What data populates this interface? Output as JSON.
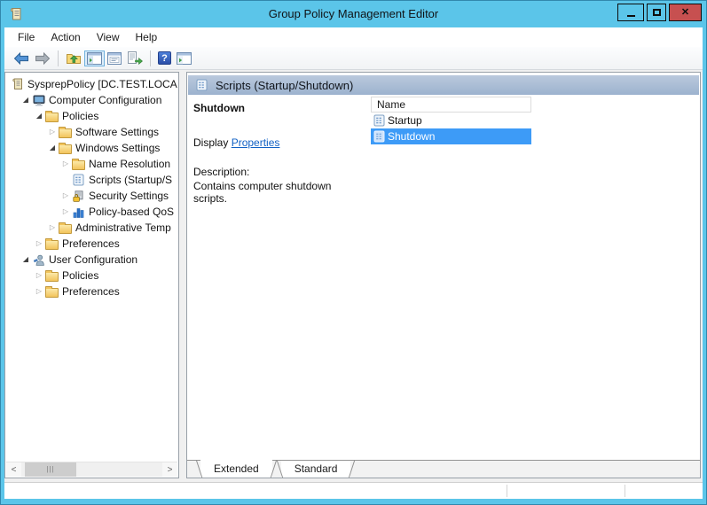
{
  "window": {
    "title": "Group Policy Management Editor",
    "accent_color": "#5bc5e9",
    "close_button_color": "#c75050"
  },
  "menu": {
    "items": [
      {
        "label": "File"
      },
      {
        "label": "Action"
      },
      {
        "label": "View"
      },
      {
        "label": "Help"
      }
    ]
  },
  "toolbar": {
    "icons": [
      "back",
      "forward",
      "up-one-level",
      "show-console-tree",
      "properties",
      "export-list",
      "help",
      "new-window"
    ]
  },
  "tree": {
    "items": [
      {
        "label": "SysprepPolicy [DC.TEST.LOCAL]",
        "level": 0,
        "state": "none",
        "icon": "gpo-scroll"
      },
      {
        "label": "Computer Configuration",
        "level": 1,
        "state": "expanded",
        "icon": "computer"
      },
      {
        "label": "Policies",
        "level": 2,
        "state": "expanded",
        "icon": "folder"
      },
      {
        "label": "Software Settings",
        "level": 3,
        "state": "collapsed",
        "icon": "folder"
      },
      {
        "label": "Windows Settings",
        "level": 3,
        "state": "expanded",
        "icon": "folder"
      },
      {
        "label": "Name Resolution",
        "level": 4,
        "state": "collapsed",
        "icon": "folder"
      },
      {
        "label": "Scripts (Startup/S",
        "level": 4,
        "state": "none",
        "icon": "scripts"
      },
      {
        "label": "Security Settings",
        "level": 4,
        "state": "collapsed",
        "icon": "security"
      },
      {
        "label": "Policy-based QoS",
        "level": 4,
        "state": "collapsed",
        "icon": "qos"
      },
      {
        "label": "Administrative Temp",
        "level": 3,
        "state": "collapsed",
        "icon": "folder"
      },
      {
        "label": "Preferences",
        "level": 2,
        "state": "collapsed",
        "icon": "folder"
      },
      {
        "label": "User Configuration",
        "level": 1,
        "state": "expanded",
        "icon": "user"
      },
      {
        "label": "Policies",
        "level": 2,
        "state": "collapsed",
        "icon": "folder"
      },
      {
        "label": "Preferences",
        "level": 2,
        "state": "collapsed",
        "icon": "folder"
      }
    ]
  },
  "content": {
    "header_title": "Scripts (Startup/Shutdown)",
    "item_name": "Shutdown",
    "display_label": "Display",
    "properties_link": "Properties",
    "description_label": "Description:",
    "description_text": "Contains computer shutdown scripts.",
    "selection_color": "#3d9bf7",
    "list": {
      "columns": [
        {
          "label": "Name"
        }
      ],
      "rows": [
        {
          "name": "Startup",
          "selected": false
        },
        {
          "name": "Shutdown",
          "selected": true
        }
      ]
    }
  },
  "tabs": {
    "items": [
      {
        "label": "Extended",
        "active": true
      },
      {
        "label": "Standard",
        "active": false
      }
    ]
  },
  "statusbar": {
    "sections": [
      "",
      "",
      ""
    ]
  }
}
